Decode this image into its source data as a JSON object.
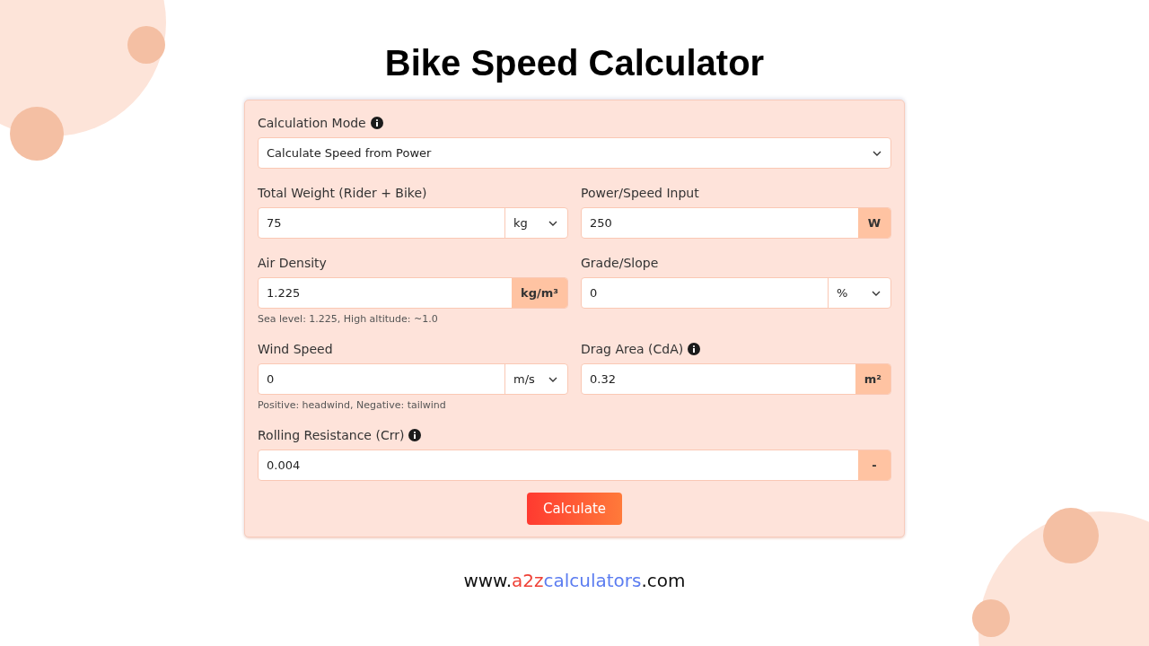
{
  "title": "Bike Speed Calculator",
  "mode": {
    "label": "Calculation Mode",
    "info": true,
    "value": "Calculate Speed from Power"
  },
  "rows": [
    [
      {
        "label": "Total Weight (Rider + Bike)",
        "info": false,
        "value": "75",
        "unit": "kg",
        "kind": "select"
      },
      {
        "label": "Power/Speed Input",
        "info": false,
        "value": "250",
        "unit": "W",
        "kind": "addon"
      }
    ],
    [
      {
        "label": "Air Density",
        "info": false,
        "value": "1.225",
        "unit": "kg/m³",
        "kind": "addon",
        "hint": "Sea level: 1.225, High altitude: ~1.0"
      },
      {
        "label": "Grade/Slope",
        "info": false,
        "value": "0",
        "unit": "%",
        "kind": "select"
      }
    ],
    [
      {
        "label": "Wind Speed",
        "info": false,
        "value": "0",
        "unit": "m/s",
        "kind": "select",
        "hint": "Positive: headwind, Negative: tailwind"
      },
      {
        "label": "Drag Area (CdA)",
        "info": true,
        "value": "0.32",
        "unit": "m²",
        "kind": "addon"
      }
    ],
    [
      {
        "label": "Rolling Resistance (Crr)",
        "info": true,
        "value": "0.004",
        "unit": "-",
        "kind": "addon"
      }
    ]
  ],
  "button": "Calculate",
  "footer": [
    {
      "text": "www.",
      "color": "#111111"
    },
    {
      "text": "a2z",
      "color": "#ef4136"
    },
    {
      "text": "calculators",
      "color": "#5b7cf0"
    },
    {
      "text": ".com",
      "color": "#111111"
    }
  ]
}
